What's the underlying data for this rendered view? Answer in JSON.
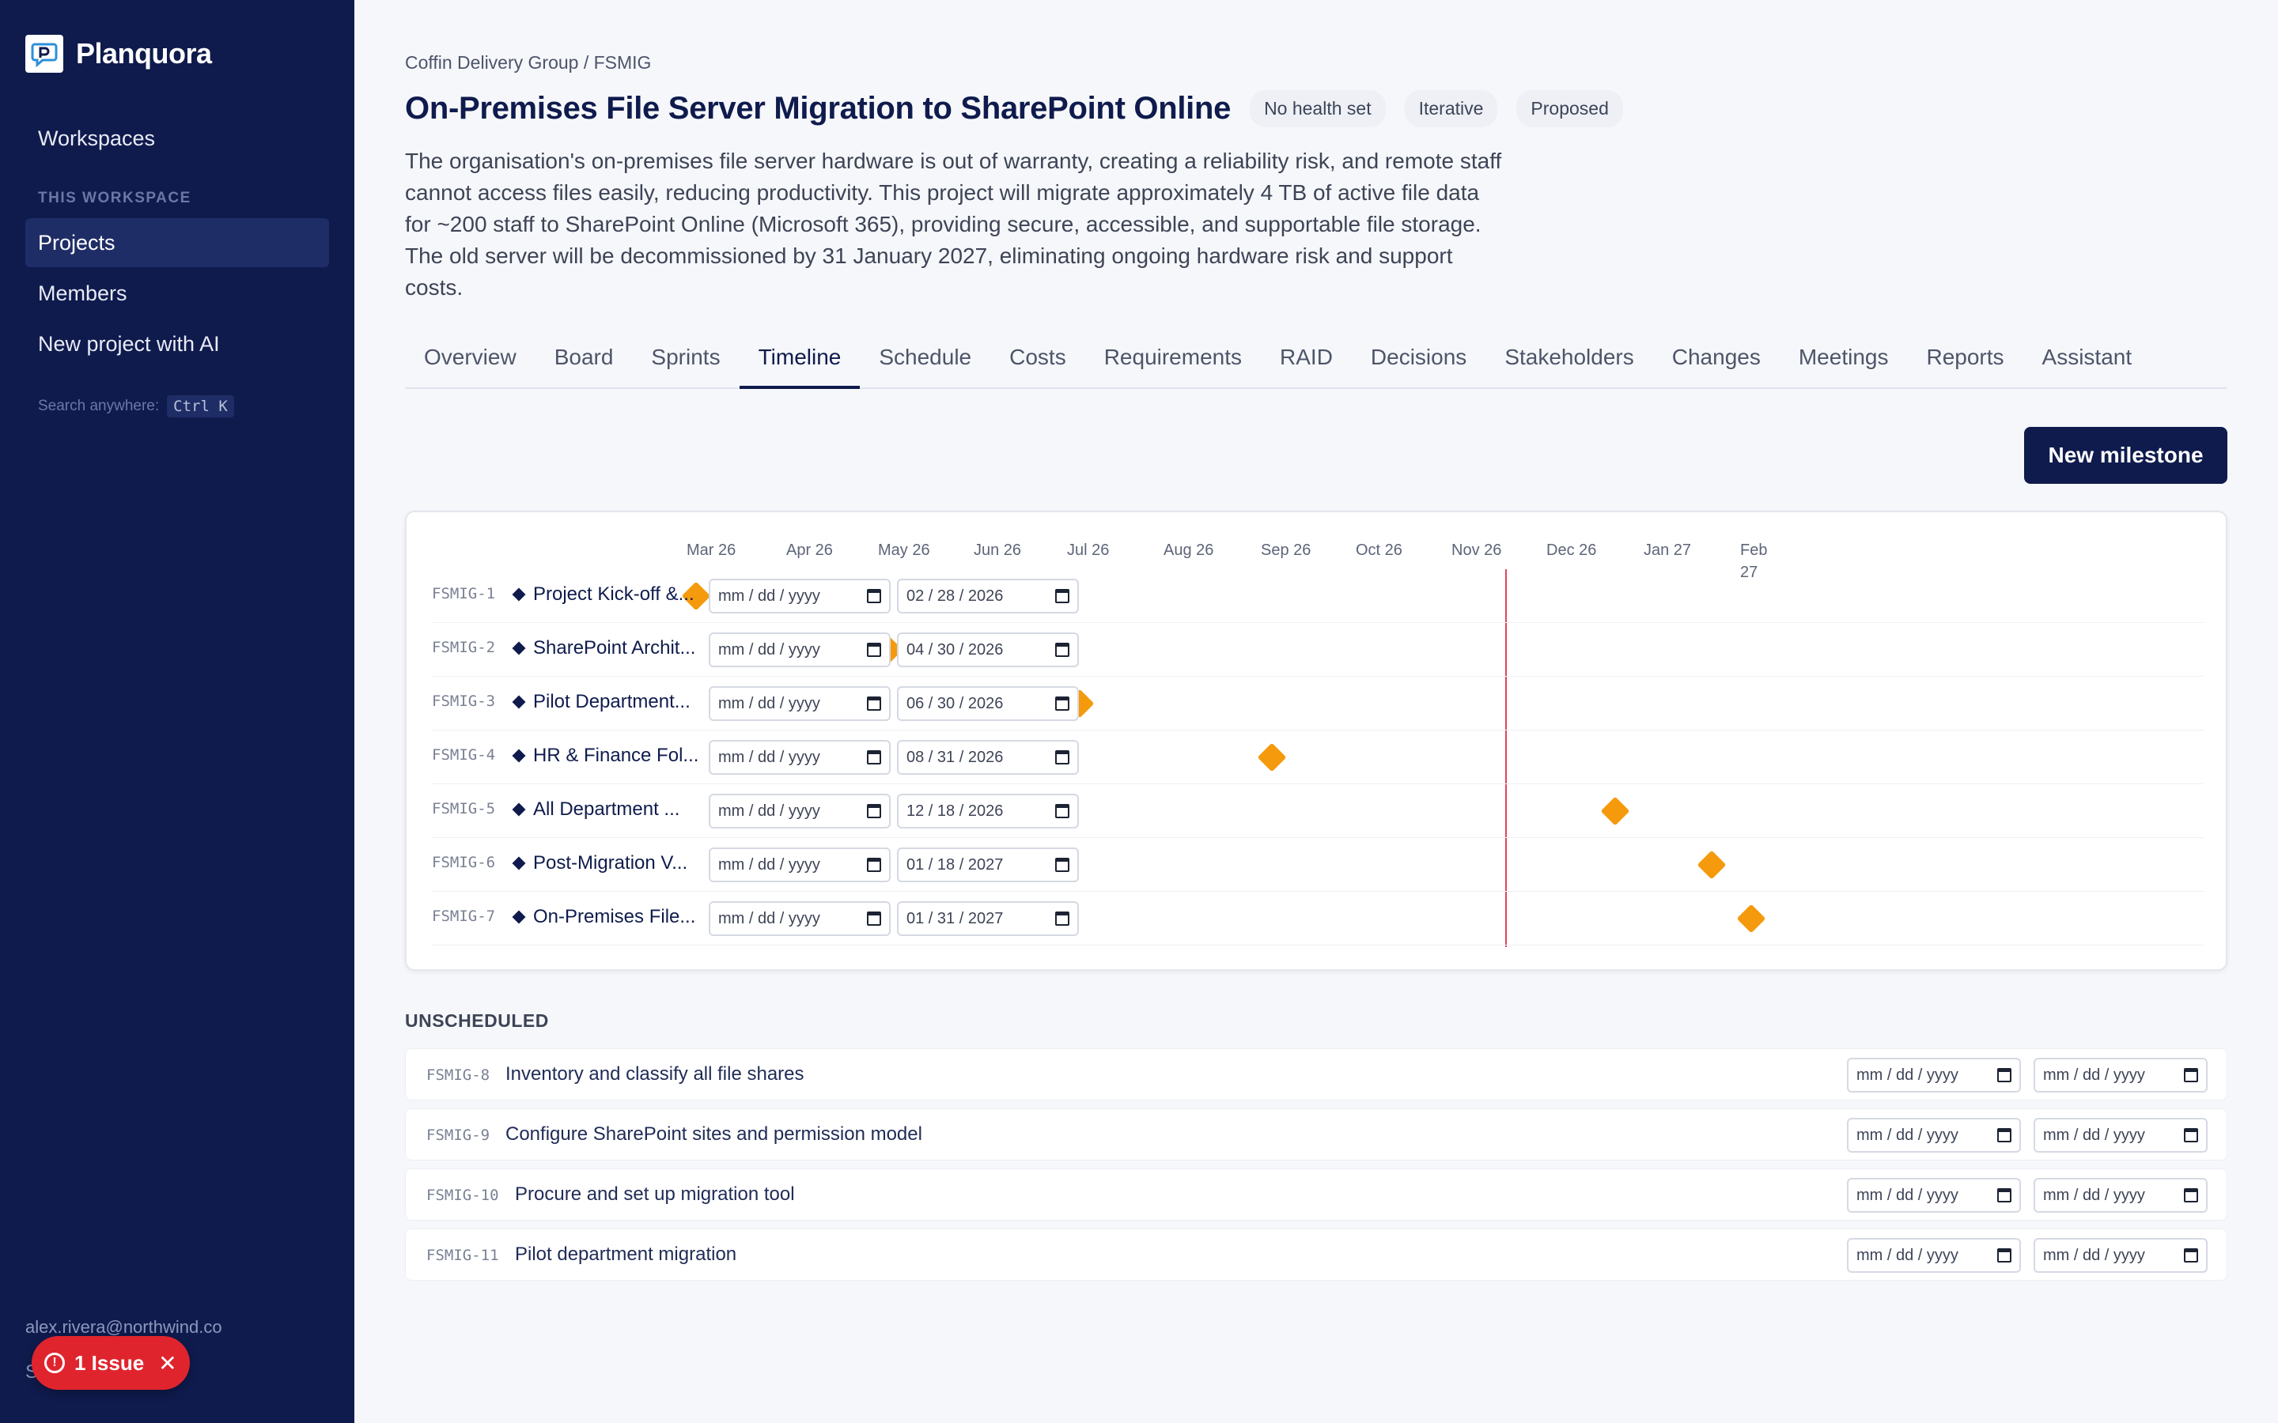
{
  "app": {
    "name": "Planquora"
  },
  "sidebar": {
    "workspaces": "Workspaces",
    "section_label": "THIS WORKSPACE",
    "items": [
      {
        "label": "Projects",
        "active": true
      },
      {
        "label": "Members"
      },
      {
        "label": "New project with AI"
      }
    ],
    "search_hint": "Search anywhere:",
    "search_kbd": "Ctrl K",
    "user_email": "alex.rivera@northwind.co",
    "user_initial": "S",
    "issue_label": "1 Issue"
  },
  "project": {
    "breadcrumb": "Coffin Delivery Group / FSMIG",
    "title": "On-Premises File Server Migration to SharePoint Online",
    "badges": [
      "No health set",
      "Iterative",
      "Proposed"
    ],
    "description": "The organisation's on-premises file server hardware is out of warranty, creating a reliability risk, and remote staff cannot access files easily, reducing productivity. This project will migrate approximately 4 TB of active file data for ~200 staff to SharePoint Online (Microsoft 365), providing secure, accessible, and supportable file storage. The old server will be decommissioned by 31 January 2027, eliminating ongoing hardware risk and support costs."
  },
  "tabs": [
    "Overview",
    "Board",
    "Sprints",
    "Timeline",
    "Schedule",
    "Costs",
    "Requirements",
    "RAID",
    "Decisions",
    "Stakeholders",
    "Changes",
    "Meetings",
    "Reports",
    "Assistant"
  ],
  "active_tab": "Timeline",
  "actions": {
    "new_milestone": "New milestone"
  },
  "date_placeholder": "mm / dd / yyyy",
  "timeline": {
    "months": [
      "Mar 26",
      "Apr 26",
      "May 26",
      "Jun 26",
      "Jul 26",
      "Aug 26",
      "Sep 26",
      "Oct 26",
      "Nov 26",
      "Dec 26",
      "Jan 27",
      "Feb 27"
    ],
    "today": "2026-11-13",
    "milestones": [
      {
        "key": "FSMIG-1",
        "name": "Project Kick-off &...",
        "start": "",
        "due": "02 / 28 / 2026",
        "date": "2026-02-28"
      },
      {
        "key": "FSMIG-2",
        "name": "SharePoint Archit...",
        "start": "",
        "due": "04 / 30 / 2026",
        "date": "2026-04-30"
      },
      {
        "key": "FSMIG-3",
        "name": "Pilot Department...",
        "start": "",
        "due": "06 / 30 / 2026",
        "date": "2026-06-30"
      },
      {
        "key": "FSMIG-4",
        "name": "HR & Finance Fol...",
        "start": "",
        "due": "08 / 31 / 2026",
        "date": "2026-08-31"
      },
      {
        "key": "FSMIG-5",
        "name": "All Department ...",
        "start": "",
        "due": "12 / 18 / 2026",
        "date": "2026-12-18"
      },
      {
        "key": "FSMIG-6",
        "name": "Post-Migration V...",
        "start": "",
        "due": "01 / 18 / 2027",
        "date": "2027-01-18"
      },
      {
        "key": "FSMIG-7",
        "name": "On-Premises File...",
        "start": "",
        "due": "01 / 31 / 2027",
        "date": "2027-01-31"
      }
    ]
  },
  "unscheduled": {
    "title": "UNSCHEDULED",
    "items": [
      {
        "key": "FSMIG-8",
        "name": "Inventory and classify all file shares"
      },
      {
        "key": "FSMIG-9",
        "name": "Configure SharePoint sites and permission model"
      },
      {
        "key": "FSMIG-10",
        "name": "Procure and set up migration tool"
      },
      {
        "key": "FSMIG-11",
        "name": "Pilot department migration"
      }
    ]
  },
  "colors": {
    "sidebar_bg": "#0f1b4d",
    "accent": "#0f1b4d",
    "milestone": "#f59a0c",
    "today_line": "#e0445a",
    "issue": "#e0242e"
  }
}
